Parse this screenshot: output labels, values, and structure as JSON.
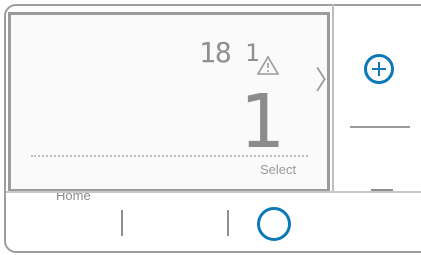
{
  "screen": {
    "small_digits": "18",
    "sep_digit": "1",
    "main_digit": "1",
    "select_label": "Select",
    "home_label": "Home",
    "chevron_glyph": "〉"
  },
  "icons": {
    "warning": "warning-icon",
    "chevron": "chevron-right-icon",
    "plus": "plus-circle-icon",
    "circle": "circle-icon"
  },
  "colors": {
    "accent": "#0b78b8",
    "lcd_text": "#8f8f8f",
    "frame": "#9d9d9d"
  }
}
